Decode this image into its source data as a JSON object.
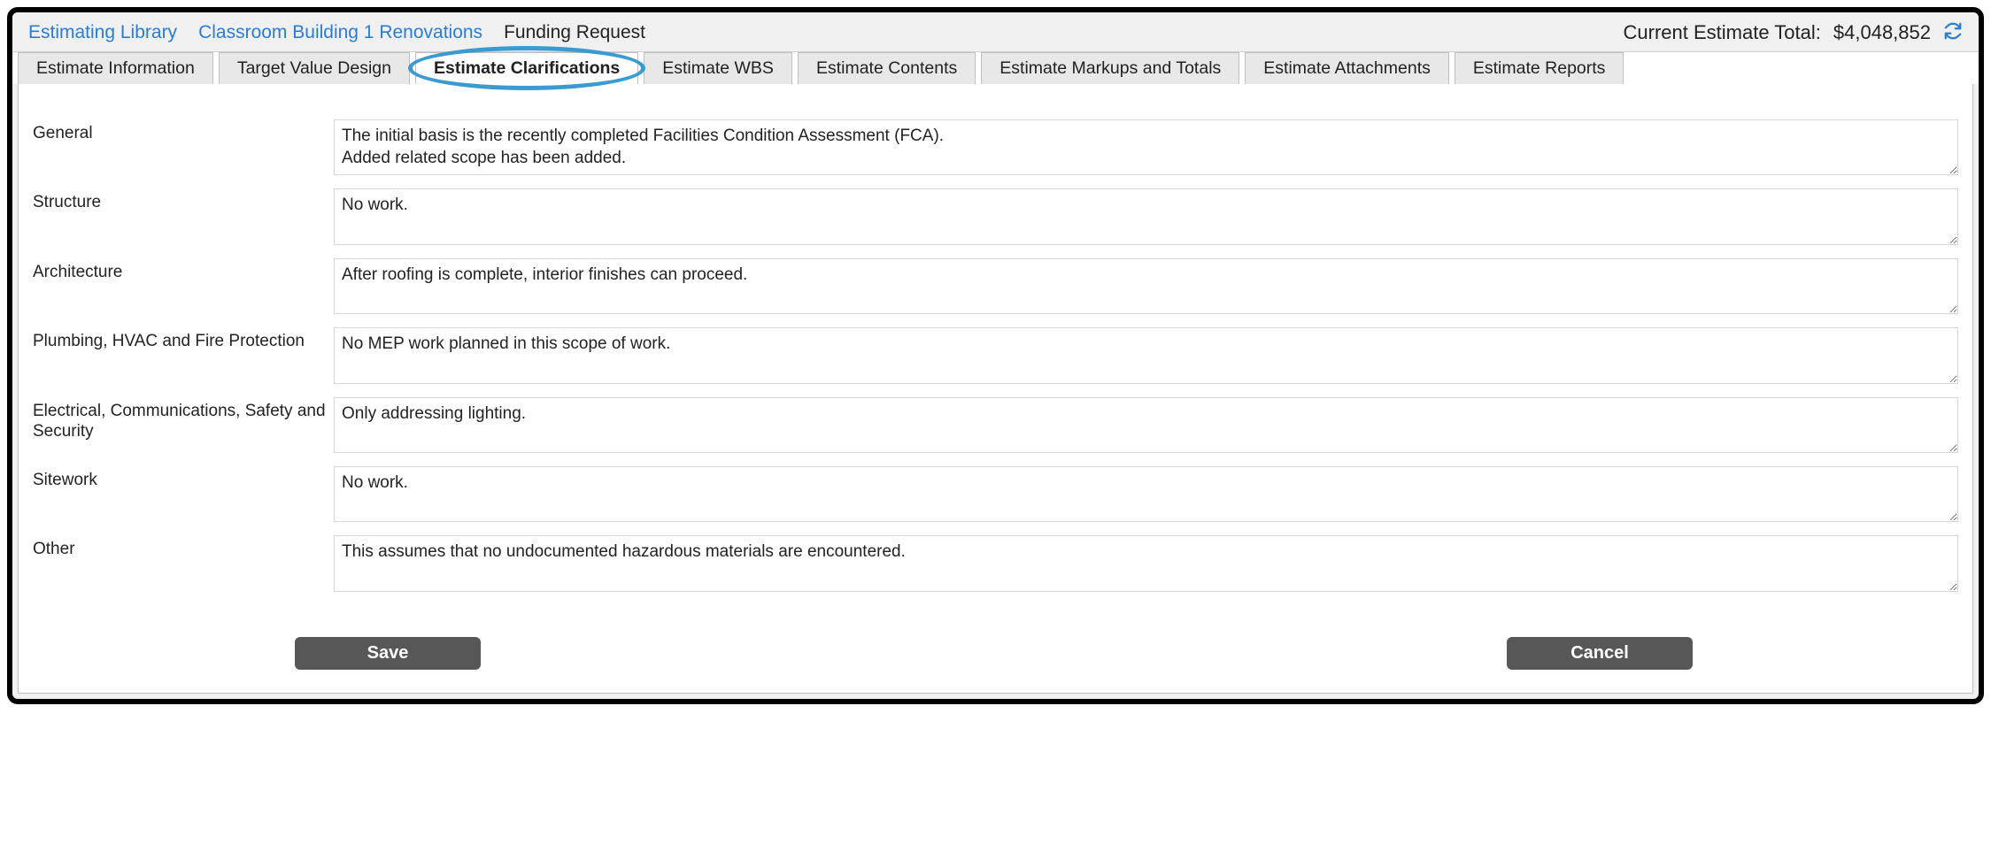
{
  "breadcrumb": {
    "library": "Estimating Library",
    "project": "Classroom Building 1 Renovations",
    "page": "Funding Request"
  },
  "header": {
    "total_label": "Current Estimate Total:",
    "total_value": "$4,048,852"
  },
  "tabs": [
    {
      "label": "Estimate Information",
      "active": false
    },
    {
      "label": "Target Value Design",
      "active": false
    },
    {
      "label": "Estimate Clarifications",
      "active": true
    },
    {
      "label": "Estimate WBS",
      "active": false
    },
    {
      "label": "Estimate Contents",
      "active": false
    },
    {
      "label": "Estimate Markups and Totals",
      "active": false
    },
    {
      "label": "Estimate Attachments",
      "active": false
    },
    {
      "label": "Estimate Reports",
      "active": false
    }
  ],
  "fields": [
    {
      "key": "general",
      "label": "General",
      "value": "The initial basis is the recently completed Facilities Condition Assessment (FCA).\nAdded related scope has been added.",
      "rows": 2
    },
    {
      "key": "structure",
      "label": "Structure",
      "value": "No work.",
      "rows": 2
    },
    {
      "key": "architecture",
      "label": "Architecture",
      "value": "After roofing is complete, interior finishes can proceed.",
      "rows": 2
    },
    {
      "key": "mep",
      "label": "Plumbing, HVAC and Fire Protection",
      "value": "No MEP work planned in this scope of work.",
      "rows": 2
    },
    {
      "key": "elec",
      "label": "Electrical, Communications, Safety and Security",
      "value": "Only addressing lighting.",
      "rows": 2
    },
    {
      "key": "sitework",
      "label": "Sitework",
      "value": "No work.",
      "rows": 2
    },
    {
      "key": "other",
      "label": "Other",
      "value": "This assumes that no undocumented hazardous materials are encountered.",
      "rows": 2
    }
  ],
  "buttons": {
    "save": "Save",
    "cancel": "Cancel"
  }
}
